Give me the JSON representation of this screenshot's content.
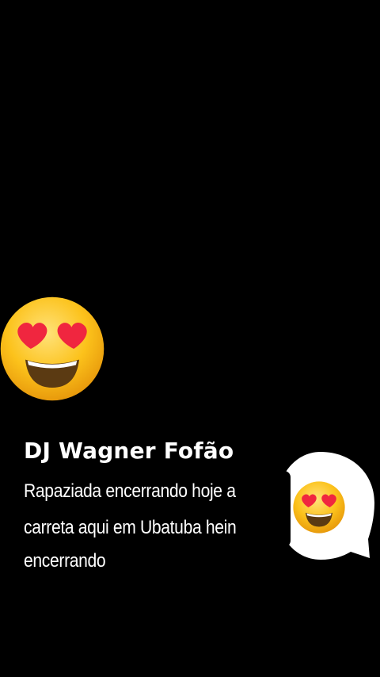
{
  "video": {
    "background_color": "#000000"
  },
  "stickers": {
    "big_emoji_icon": "smiling-face-with-heart-eyes",
    "bubble_emoji_icon": "smiling-face-with-heart-eyes"
  },
  "caption": {
    "author": "DJ Wagner Fofão",
    "lines": [
      "Rapaziada encerrando hoje a",
      "carreta aqui em Ubatuba hein",
      "encerrando"
    ]
  }
}
